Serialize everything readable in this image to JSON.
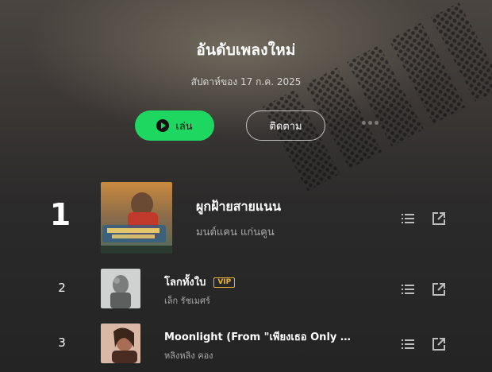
{
  "header": {
    "title": "อันดับเพลงใหม่",
    "subtitle": "สัปดาห์ของ 17 ก.ค. 2025"
  },
  "actions": {
    "play_label": "เล่น",
    "follow_label": "ติดตาม"
  },
  "icons": {
    "play": "play-circle-icon",
    "more": "more-dots-icon",
    "list": "list-icon",
    "share": "share-external-icon"
  },
  "colors": {
    "accent": "#1ed760",
    "vip": "#e6b43a"
  },
  "tracks": [
    {
      "rank": "1",
      "title": "ผูกฝ้ายสายแนน",
      "artist": "มนต์แคน แก่นคูน",
      "vip": ""
    },
    {
      "rank": "2",
      "title": "โลกทั้งใบ",
      "artist": "เล็ก รัชเมศร์",
      "vip": "VIP"
    },
    {
      "rank": "3",
      "title": "Moonlight (From \"เพียงเธอ Only You\")",
      "artist": "หลิงหลิง คอง",
      "vip": ""
    }
  ]
}
